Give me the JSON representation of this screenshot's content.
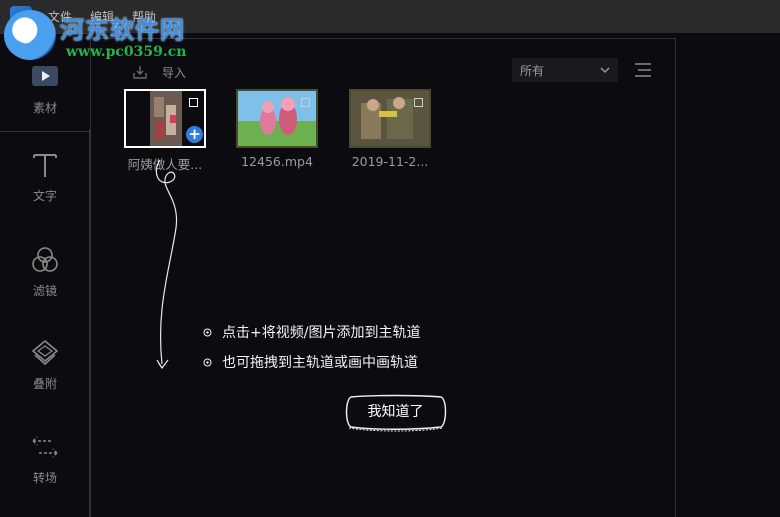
{
  "menubar": {
    "items": [
      "文件",
      "编辑",
      "帮助"
    ]
  },
  "watermark": {
    "text": "河东软件网",
    "url": "www.pc0359.cn"
  },
  "sidebar": {
    "items": [
      {
        "label": "素材",
        "icon": "play-media-icon",
        "active": true
      },
      {
        "label": "文字",
        "icon": "text-t-icon",
        "active": false
      },
      {
        "label": "滤镜",
        "icon": "filter-circles-icon",
        "active": false
      },
      {
        "label": "叠附",
        "icon": "overlay-layers-icon",
        "active": false
      },
      {
        "label": "转场",
        "icon": "transition-arrows-icon",
        "active": false
      }
    ]
  },
  "toolbar": {
    "import_label": "导入",
    "filter_value": "所有"
  },
  "media": {
    "items": [
      {
        "name": "阿姨做人要...",
        "selected": true
      },
      {
        "name": "12456.mp4",
        "selected": false
      },
      {
        "name": "2019-11-2...",
        "selected": false
      }
    ]
  },
  "guide": {
    "tips": [
      "点击+将视频/图片添加到主轨道",
      "也可拖拽到主轨道或画中画轨道"
    ],
    "button_label": "我知道了"
  },
  "colors": {
    "background": "#0c0c10",
    "menubar": "#2a2a2c",
    "accent": "#2d7de0",
    "border": "#2f3540"
  }
}
